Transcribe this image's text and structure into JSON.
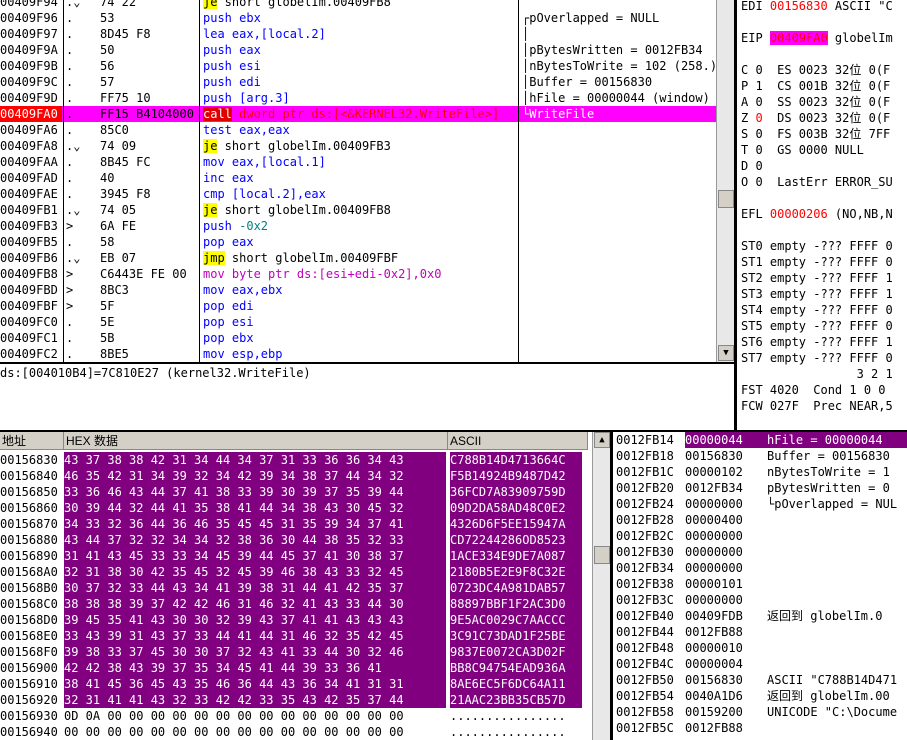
{
  "disasm": {
    "rows": [
      {
        "addr": "00409F94",
        "flag": ".⌄",
        "hex": "74 22",
        "mnem": "je",
        "mcls": "m-jcc",
        "ops": "short globelIm.00409FB8",
        "ocls": "o-blk"
      },
      {
        "addr": "00409F96",
        "flag": ".",
        "hex": "53",
        "mnem": "push",
        "mcls": "m-blue",
        "ops": "ebx",
        "ocls": "o-blue"
      },
      {
        "addr": "00409F97",
        "flag": ".",
        "hex": "8D45 F8",
        "mnem": "lea",
        "mcls": "m-blue",
        "ops": "eax,[local.2]",
        "ocls": "o-blue"
      },
      {
        "addr": "00409F9A",
        "flag": ".",
        "hex": "50",
        "mnem": "push",
        "mcls": "m-blue",
        "ops": "eax",
        "ocls": "o-blue"
      },
      {
        "addr": "00409F9B",
        "flag": ".",
        "hex": "56",
        "mnem": "push",
        "mcls": "m-blue",
        "ops": "esi",
        "ocls": "o-blue"
      },
      {
        "addr": "00409F9C",
        "flag": ".",
        "hex": "57",
        "mnem": "push",
        "mcls": "m-blue",
        "ops": "edi",
        "ocls": "o-blue"
      },
      {
        "addr": "00409F9D",
        "flag": ".",
        "hex": "FF75 10",
        "mnem": "push",
        "mcls": "m-blue",
        "ops": "[arg.3]",
        "ocls": "o-blue"
      },
      {
        "addr": "00409FA0",
        "flag": ".",
        "hex": "FF15 B4104000",
        "mnem": "call",
        "mcls": "m-red",
        "ops": "dword ptr ds:[<&KERNEL32.WriteFile>]",
        "ocls": "o-red"
      },
      {
        "addr": "00409FA6",
        "flag": ".",
        "hex": "85C0",
        "mnem": "test",
        "mcls": "m-blue",
        "ops": "eax,eax",
        "ocls": "o-blue"
      },
      {
        "addr": "00409FA8",
        "flag": ".⌄",
        "hex": "74 09",
        "mnem": "je",
        "mcls": "m-jcc",
        "ops": "short globelIm.00409FB3",
        "ocls": "o-blk"
      },
      {
        "addr": "00409FAA",
        "flag": ".",
        "hex": "8B45 FC",
        "mnem": "mov",
        "mcls": "m-blue",
        "ops": "eax,[local.1]",
        "ocls": "o-blue"
      },
      {
        "addr": "00409FAD",
        "flag": ".",
        "hex": "40",
        "mnem": "inc",
        "mcls": "m-blue",
        "ops": "eax",
        "ocls": "o-blue"
      },
      {
        "addr": "00409FAE",
        "flag": ".",
        "hex": "3945 F8",
        "mnem": "cmp",
        "mcls": "m-blue",
        "ops": "[local.2],eax",
        "ocls": "o-blue"
      },
      {
        "addr": "00409FB1",
        "flag": ".⌄",
        "hex": "74 05",
        "mnem": "je",
        "mcls": "m-jcc",
        "ops": "short globelIm.00409FB8",
        "ocls": "o-blk"
      },
      {
        "addr": "00409FB3",
        "flag": ">",
        "hex": "6A FE",
        "mnem": "push",
        "mcls": "m-blue",
        "ops": "-0x2",
        "ocls": "o-dk"
      },
      {
        "addr": "00409FB5",
        "flag": ".",
        "hex": "58",
        "mnem": "pop",
        "mcls": "m-blue",
        "ops": "eax",
        "ocls": "o-blue"
      },
      {
        "addr": "00409FB6",
        "flag": ".⌄",
        "hex": "EB 07",
        "mnem": "jmp",
        "mcls": "m-jmp",
        "ops": "short globelIm.00409FBF",
        "ocls": "o-blk"
      },
      {
        "addr": "00409FB8",
        "flag": ">",
        "hex": "C6443E FE 00",
        "mnem": "mov",
        "mcls": "m-mag",
        "ops": "byte ptr ds:[esi+edi-0x2],0x0",
        "ocls": "o-mag"
      },
      {
        "addr": "00409FBD",
        "flag": ">",
        "hex": "8BC3",
        "mnem": "mov",
        "mcls": "m-blue",
        "ops": "eax,ebx",
        "ocls": "o-blue"
      },
      {
        "addr": "00409FBF",
        "flag": ">",
        "hex": "5F",
        "mnem": "pop",
        "mcls": "m-blue",
        "ops": "edi",
        "ocls": "o-blue"
      },
      {
        "addr": "00409FC0",
        "flag": ".",
        "hex": "5E",
        "mnem": "pop",
        "mcls": "m-blue",
        "ops": "esi",
        "ocls": "o-blue"
      },
      {
        "addr": "00409FC1",
        "flag": ".",
        "hex": "5B",
        "mnem": "pop",
        "mcls": "m-blue",
        "ops": "ebx",
        "ocls": "o-blue"
      },
      {
        "addr": "00409FC2",
        "flag": ".",
        "hex": "8BE5",
        "mnem": "mov",
        "mcls": "m-blue",
        "ops": "esp,ebp",
        "ocls": "o-blue"
      }
    ],
    "comments": [
      "",
      "┌pOverlapped = NULL",
      "│",
      "│pBytesWritten = 0012FB34",
      "│nBytesToWrite = 102 (258.)",
      "│Buffer = 00156830",
      "│hFile = 00000044 (window)",
      "└WriteFile"
    ]
  },
  "info_line": "ds:[004010B4]=7C810E27 (kernel32.WriteFile)",
  "registers": [
    {
      "t": "EDI ",
      "v": "00156830",
      "r": " ASCII \"C"
    },
    {
      "t": "",
      "v": "",
      "r": ""
    },
    {
      "t": "EIP ",
      "v": "00409FA0",
      "r": " globelIm",
      "hl": true
    },
    {
      "t": "",
      "v": "",
      "r": ""
    },
    {
      "t": "C 0  ES 0023 32位 0(F",
      "v": "",
      "r": ""
    },
    {
      "t": "P 1  CS 001B 32位 0(F",
      "v": "",
      "r": ""
    },
    {
      "t": "A 0  SS 0023 32位 0(F",
      "v": "",
      "r": ""
    },
    {
      "t": "Z ",
      "v": "0",
      "r": "  DS 0023 32位 0(F"
    },
    {
      "t": "S 0  FS 003B 32位 7FF",
      "v": "",
      "r": ""
    },
    {
      "t": "T 0  GS 0000 NULL",
      "v": "",
      "r": ""
    },
    {
      "t": "D 0",
      "v": "",
      "r": ""
    },
    {
      "t": "O 0  LastErr ERROR_SU",
      "v": "",
      "r": ""
    },
    {
      "t": "",
      "v": "",
      "r": ""
    },
    {
      "t": "EFL ",
      "v": "00000206",
      "r": " (NO,NB,N"
    },
    {
      "t": "",
      "v": "",
      "r": ""
    },
    {
      "t": "ST0 empty -??? FFFF 0",
      "v": "",
      "r": ""
    },
    {
      "t": "ST1 empty -??? FFFF 0",
      "v": "",
      "r": ""
    },
    {
      "t": "ST2 empty -??? FFFF 1",
      "v": "",
      "r": ""
    },
    {
      "t": "ST3 empty -??? FFFF 1",
      "v": "",
      "r": ""
    },
    {
      "t": "ST4 empty -??? FFFF 0",
      "v": "",
      "r": ""
    },
    {
      "t": "ST5 empty -??? FFFF 0",
      "v": "",
      "r": ""
    },
    {
      "t": "ST6 empty -??? FFFF 1",
      "v": "",
      "r": ""
    },
    {
      "t": "ST7 empty -??? FFFF 0",
      "v": "",
      "r": ""
    },
    {
      "t": "                3 2 1",
      "v": "",
      "r": ""
    },
    {
      "t": "FST 4020  Cond 1 0 0",
      "v": "",
      "r": ""
    },
    {
      "t": "FCW 027F  Prec NEAR,5",
      "v": "",
      "r": ""
    }
  ],
  "dump": {
    "headers": {
      "addr": "地址",
      "hex": "HEX 数据",
      "ascii": "ASCII"
    },
    "rows": [
      {
        "a": "00156830",
        "h": "43 37 38 38 42 31 34 44 34 37 31 33 36 36 34 43",
        "c": "C788B14D4713664C",
        "hl": true
      },
      {
        "a": "00156840",
        "h": "46 35 42 31 34 39 32 34 42 39 34 38 37 44 34 32",
        "c": "F5B14924B9487D42",
        "hl": true
      },
      {
        "a": "00156850",
        "h": "33 36 46 43 44 37 41 38 33 39 30 39 37 35 39 44",
        "c": "36FCD7A83909759D",
        "hl": true
      },
      {
        "a": "00156860",
        "h": "30 39 44 32 44 41 35 38 41 44 34 38 43 30 45 32",
        "c": "09D2DA58AD48C0E2",
        "hl": true
      },
      {
        "a": "00156870",
        "h": "34 33 32 36 44 36 46 35 45 45 31 35 39 34 37 41",
        "c": "4326D6F5EE15947A",
        "hl": true
      },
      {
        "a": "00156880",
        "h": "43 44 37 32 32 34 34 32 38 36 30 44 38 35 32 33",
        "c": "CD72244286OD8523",
        "hl": true
      },
      {
        "a": "00156890",
        "h": "31 41 43 45 33 33 34 45 39 44 45 37 41 30 38 37",
        "c": "1ACE334E9DE7A087",
        "hl": true
      },
      {
        "a": "001568A0",
        "h": "32 31 38 30 42 35 45 32 45 39 46 38 43 33 32 45",
        "c": "2180B5E2E9F8C32E",
        "hl": true
      },
      {
        "a": "001568B0",
        "h": "30 37 32 33 44 43 34 41 39 38 31 44 41 42 35 37",
        "c": "0723DC4A981DAB57",
        "hl": true
      },
      {
        "a": "001568C0",
        "h": "38 38 38 39 37 42 42 46 31 46 32 41 43 33 44 30",
        "c": "88897BBF1F2AC3D0",
        "hl": true
      },
      {
        "a": "001568D0",
        "h": "39 45 35 41 43 30 30 32 39 43 37 41 41 43 43 43",
        "c": "9E5AC0029C7AACCC",
        "hl": true
      },
      {
        "a": "001568E0",
        "h": "33 43 39 31 43 37 33 44 41 44 31 46 32 35 42 45",
        "c": "3C91C73DAD1F25BE",
        "hl": true
      },
      {
        "a": "001568F0",
        "h": "39 38 33 37 45 30 30 37 32 43 41 33 44 30 32 46",
        "c": "9837E0072CA3D02F",
        "hl": true
      },
      {
        "a": "00156900",
        "h": "42 42 38 43 39 37 35 34 45 41 44 39 33 36 41",
        "c": "BB8C94754EAD936A",
        "hl": true
      },
      {
        "a": "00156910",
        "h": "38 41 45 36 45 43 35 46 36 44 43 36 34 41 31 31",
        "c": "8AE6EC5F6DC64A11",
        "hl": true
      },
      {
        "a": "00156920",
        "h": "32 31 41 41 43 32 33 42 42 33 35 43 42 35 37 44",
        "c": "21AAC23BB35CB57D",
        "hl": true
      },
      {
        "a": "00156930",
        "h": "0D 0A 00 00 00 00 00 00 00 00 00 00 00 00 00 00",
        "c": "................",
        "hl": false
      },
      {
        "a": "00156940",
        "h": "00 00 00 00 00 00 00 00 00 00 00 00 00 00 00 00",
        "c": "................",
        "hl": false
      }
    ]
  },
  "stack": {
    "rows": [
      {
        "a": "0012FB14",
        "v": "00000044",
        "c": "hFile = 00000044",
        "hl": true
      },
      {
        "a": "0012FB18",
        "v": "00156830",
        "c": "Buffer = 00156830",
        "hl": false
      },
      {
        "a": "0012FB1C",
        "v": "00000102",
        "c": "nBytesToWrite = 1",
        "hl": false
      },
      {
        "a": "0012FB20",
        "v": "0012FB34",
        "c": "pBytesWritten = 0",
        "hl": false
      },
      {
        "a": "0012FB24",
        "v": "00000000",
        "c": "└pOverlapped = NUL",
        "hl": false
      },
      {
        "a": "0012FB28",
        "v": "00000400",
        "c": "",
        "hl": false
      },
      {
        "a": "0012FB2C",
        "v": "00000000",
        "c": "",
        "hl": false
      },
      {
        "a": "0012FB30",
        "v": "00000000",
        "c": "",
        "hl": false
      },
      {
        "a": "0012FB34",
        "v": "00000000",
        "c": "",
        "hl": false
      },
      {
        "a": "0012FB38",
        "v": "00000101",
        "c": "",
        "hl": false
      },
      {
        "a": "0012FB3C",
        "v": "00000000",
        "c": "",
        "hl": false
      },
      {
        "a": "0012FB40",
        "v": "00409FDB",
        "c": "返回到 globelIm.0",
        "hl": false
      },
      {
        "a": "0012FB44",
        "v": "0012FB88",
        "c": "",
        "hl": false
      },
      {
        "a": "0012FB48",
        "v": "00000010",
        "c": "",
        "hl": false
      },
      {
        "a": "0012FB4C",
        "v": "00000004",
        "c": "",
        "hl": false
      },
      {
        "a": "0012FB50",
        "v": "00156830",
        "c": "ASCII \"C788B14D471",
        "hl": false
      },
      {
        "a": "0012FB54",
        "v": "0040A1D6",
        "c": "返回到 globelIm.00",
        "hl": false
      },
      {
        "a": "0012FB58",
        "v": "00159200",
        "c": "UNICODE \"C:\\Docume",
        "hl": false
      },
      {
        "a": "0012FB5C",
        "v": "0012FB88",
        "c": "",
        "hl": false
      }
    ]
  },
  "colors": {
    "highlight": "#ff00ff",
    "dump_highlight": "#800080",
    "call_bg": "#e00000",
    "jump_bg": "#ffff00"
  }
}
